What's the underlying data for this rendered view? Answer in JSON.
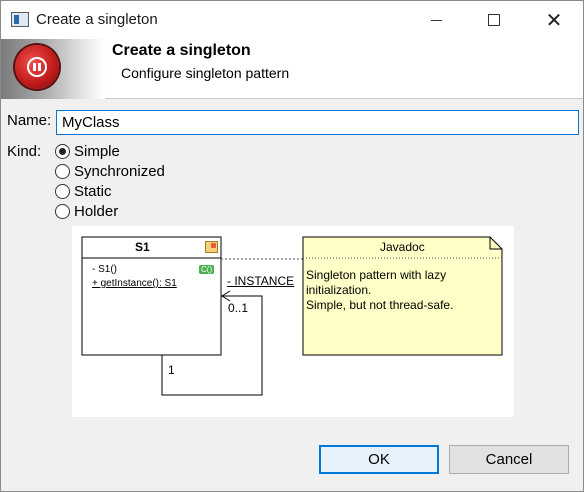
{
  "window": {
    "title": "Create a singleton"
  },
  "banner": {
    "title": "Create a singleton",
    "subtitle": "Configure singleton pattern"
  },
  "form": {
    "name_label": "Name:",
    "name_value": "MyClass",
    "kind_label": "Kind:",
    "kinds": [
      {
        "label": "Simple",
        "checked": true
      },
      {
        "label": "Synchronized",
        "checked": false
      },
      {
        "label": "Static",
        "checked": false
      },
      {
        "label": "Holder",
        "checked": false
      }
    ]
  },
  "diagram": {
    "class_name": "S1",
    "constructor": "- S1()",
    "method": "+ getInstance(): S1",
    "badge": "C()",
    "association_label": "- INSTANCE",
    "multiplicity_target": "0..1",
    "multiplicity_source": "1",
    "note": {
      "title": "Javadoc",
      "line1": "Singleton pattern with lazy initialization.",
      "line2": "Simple, but not thread-safe."
    },
    "colors": {
      "note_fill": "#ffffc8",
      "badge": "#4caf50"
    }
  },
  "buttons": {
    "ok": "OK",
    "cancel": "Cancel"
  },
  "colors": {
    "accent": "#0078d7",
    "banner_icon": "#c41c1c"
  }
}
